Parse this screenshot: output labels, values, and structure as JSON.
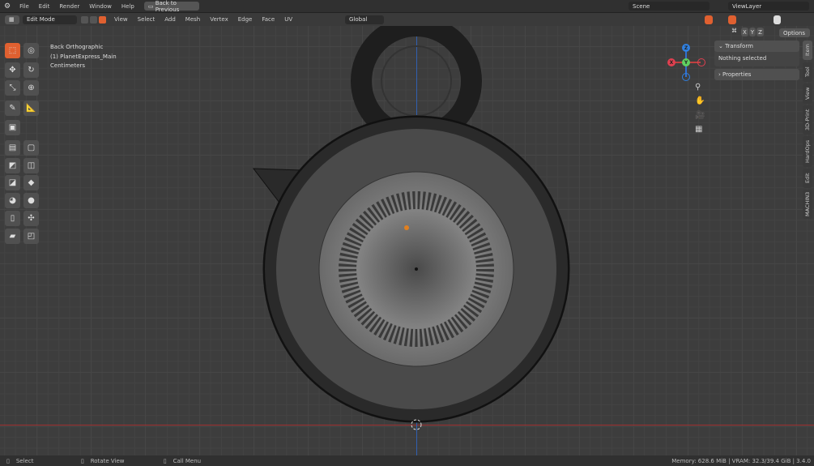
{
  "topbar": {
    "menus": [
      "File",
      "Edit",
      "Render",
      "Window",
      "Help"
    ],
    "back_button": "Back to Previous",
    "scene": "Scene",
    "view_layer": "ViewLayer"
  },
  "header": {
    "mode": "Edit Mode",
    "menus": [
      "View",
      "Select",
      "Add",
      "Mesh",
      "Vertex",
      "Edge",
      "Face",
      "UV"
    ],
    "orientation": "Global",
    "options": "Options",
    "axes": [
      "X",
      "Y",
      "Z"
    ]
  },
  "overlay": {
    "view": "Back Orthographic",
    "object": "(1) PlanetExpress_Main",
    "units": "Centimeters"
  },
  "gizmo": {
    "x": "X",
    "y": "Y",
    "z": "Z",
    "colors": {
      "x": "#e04050",
      "y": "#60d060",
      "z": "#3080e0"
    }
  },
  "npanel": {
    "transform": "Transform",
    "nothing_selected": "Nothing selected",
    "properties": "Properties",
    "tabs": [
      "Item",
      "Tool",
      "View",
      "3D-Print",
      "HardOps",
      "Edit",
      "MACHIN3"
    ]
  },
  "status": {
    "select": "Select",
    "rotate": "Rotate View",
    "call_menu": "Call Menu",
    "info": "Memory: 628.6 MiB | VRAM: 32.3/39.4 GiB | 3.4.0"
  },
  "colors": {
    "accent": "#e06030",
    "x_axis_line": "#a03030",
    "y_axis_line": "#3060b0"
  }
}
